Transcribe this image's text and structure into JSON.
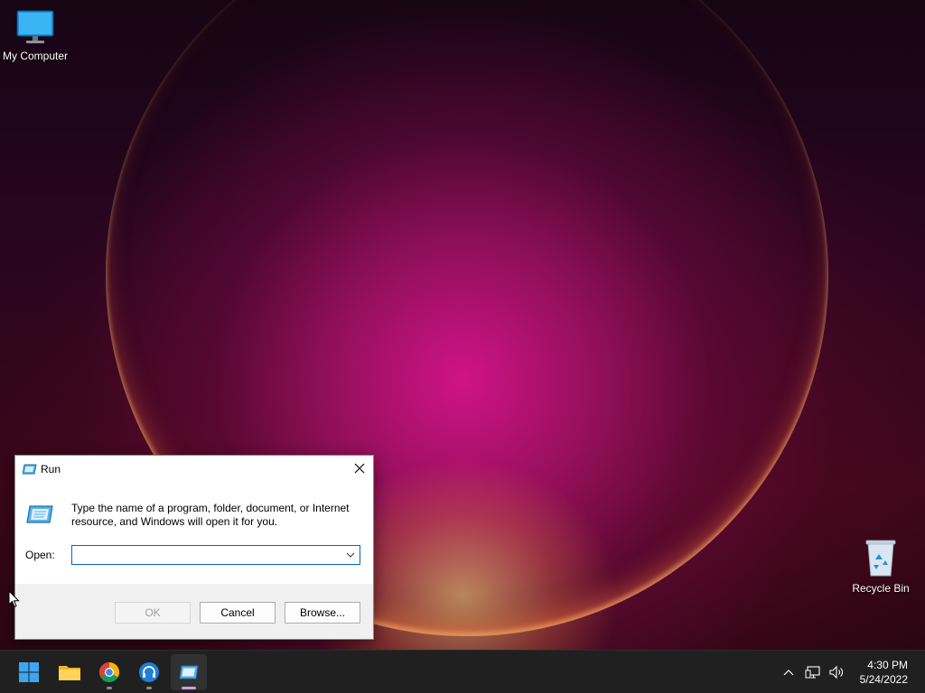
{
  "desktop": {
    "icons": [
      {
        "label": "My Computer",
        "icon": "monitor-icon"
      },
      {
        "label": "Recycle Bin",
        "icon": "recycle-bin-icon"
      }
    ]
  },
  "run_dialog": {
    "title": "Run",
    "message": "Type the name of a program, folder, document, or Internet resource, and Windows will open it for you.",
    "open_label": "Open:",
    "open_value": "",
    "ok_label": "OK",
    "cancel_label": "Cancel",
    "browse_label": "Browse..."
  },
  "taskbar": {
    "apps": [
      {
        "icon": "start-windows-icon"
      },
      {
        "icon": "file-explorer-icon"
      },
      {
        "icon": "chrome-icon"
      },
      {
        "icon": "headphones-app-icon"
      },
      {
        "icon": "run-app-icon"
      }
    ],
    "tray": {
      "icons": [
        "chevron-up-icon",
        "network-icon",
        "volume-icon"
      ],
      "time": "4:30 PM",
      "date": "5/24/2022"
    }
  },
  "colors": {
    "accent": "#0067c0",
    "taskbar_bg": "#202020",
    "dialog_footer": "#f0f0f0"
  }
}
